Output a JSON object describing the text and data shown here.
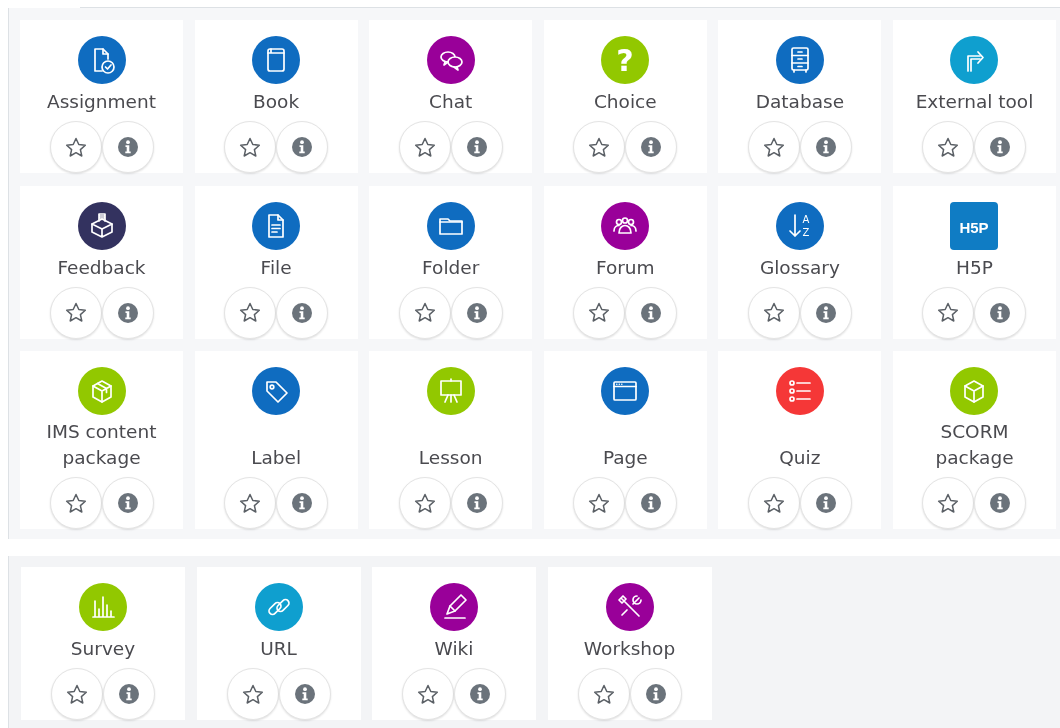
{
  "panels": [
    {
      "items": [
        {
          "name": "Assignment",
          "kind": "assignment",
          "color": "#0f6cc0"
        },
        {
          "name": "Book",
          "kind": "book",
          "color": "#0f6cc0"
        },
        {
          "name": "Chat",
          "kind": "chat",
          "color": "#990099"
        },
        {
          "name": "Choice",
          "kind": "choice",
          "color": "#92c800",
          "glyph": "?"
        },
        {
          "name": "Database",
          "kind": "database",
          "color": "#0f6cc0"
        },
        {
          "name": "External tool",
          "kind": "external",
          "color": "#0f9fcf"
        },
        {
          "name": "Feedback",
          "kind": "feedback",
          "color": "#33325f"
        },
        {
          "name": "File",
          "kind": "file",
          "color": "#0f6cc0"
        },
        {
          "name": "Folder",
          "kind": "folder",
          "color": "#0f6cc0"
        },
        {
          "name": "Forum",
          "kind": "forum",
          "color": "#990099"
        },
        {
          "name": "Glossary",
          "kind": "glossary",
          "color": "#0f6cc0",
          "glyph": "AZ"
        },
        {
          "name": "H5P",
          "kind": "h5p",
          "color": "#0f7cc4",
          "glyph": "H5P"
        },
        {
          "name": "IMS content package",
          "kind": "ims",
          "color": "#92c800"
        },
        {
          "name": "Label",
          "kind": "label",
          "color": "#0f6cc0"
        },
        {
          "name": "Lesson",
          "kind": "lesson",
          "color": "#92c800"
        },
        {
          "name": "Page",
          "kind": "page",
          "color": "#0f6cc0"
        },
        {
          "name": "Quiz",
          "kind": "quiz",
          "color": "#f53737"
        },
        {
          "name": "SCORM package",
          "kind": "scorm",
          "color": "#92c800"
        }
      ]
    },
    {
      "items": [
        {
          "name": "Survey",
          "kind": "survey",
          "color": "#92c800"
        },
        {
          "name": "URL",
          "kind": "url",
          "color": "#0f9fcf"
        },
        {
          "name": "Wiki",
          "kind": "wiki",
          "color": "#990099"
        },
        {
          "name": "Workshop",
          "kind": "workshop",
          "color": "#990099"
        }
      ]
    }
  ]
}
